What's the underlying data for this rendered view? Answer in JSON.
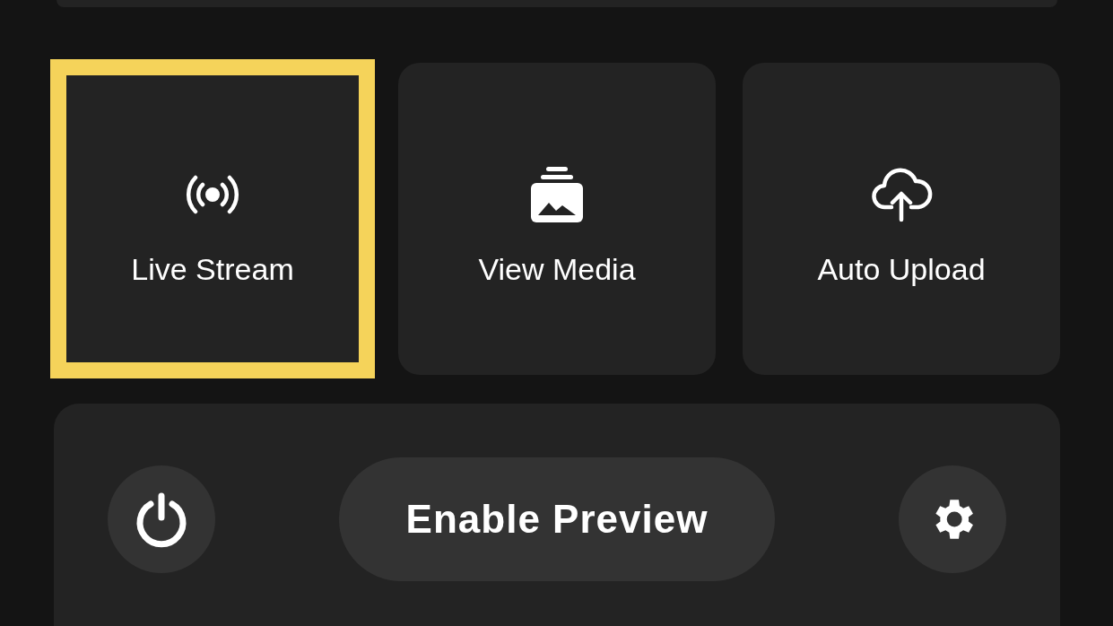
{
  "tiles": [
    {
      "kind": "live",
      "label": "Live Stream",
      "selected": true
    },
    {
      "kind": "media",
      "label": "View Media",
      "selected": false
    },
    {
      "kind": "upload",
      "label": "Auto Upload",
      "selected": false
    }
  ],
  "control_bar": {
    "preview_button": "Enable Preview"
  }
}
